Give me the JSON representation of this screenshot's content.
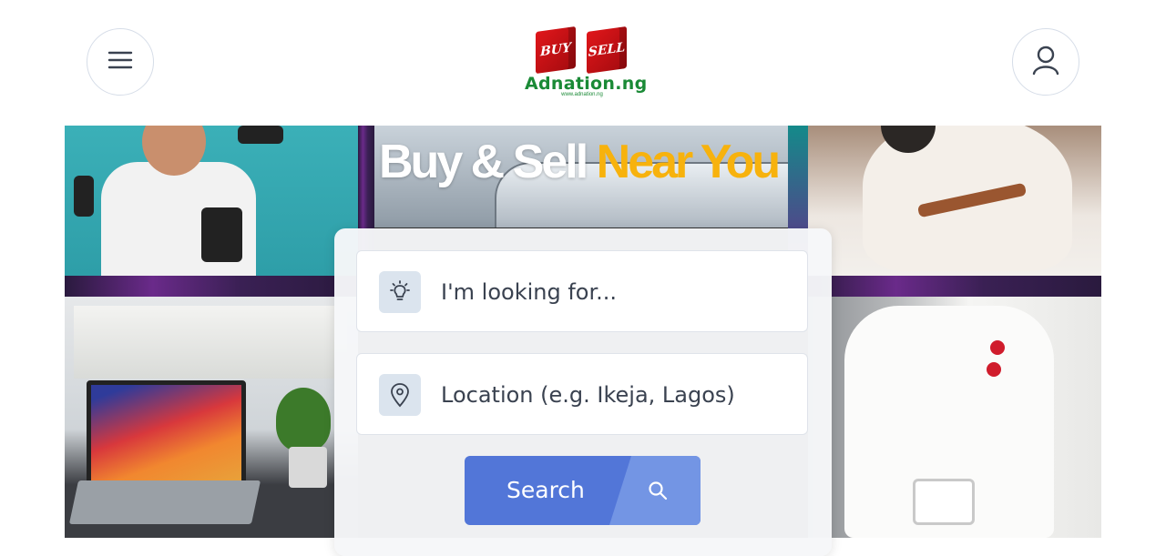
{
  "header": {
    "menu_icon": "hamburger-menu-icon",
    "account_icon": "user-icon",
    "logo": {
      "cube_left_text": "BUY",
      "cube_right_text": "SELL",
      "name": "Adnation.ng",
      "url": "www.adnation.ng"
    }
  },
  "hero": {
    "tagline_white": "Buy & Sell ",
    "tagline_yellow": "Near You"
  },
  "search": {
    "keyword_placeholder": "I'm looking for...",
    "keyword_icon": "lightbulb-icon",
    "location_placeholder": "Location (e.g. Ikeja, Lagos)",
    "location_icon": "map-pin-icon",
    "button_label": "Search",
    "button_icon": "search-icon"
  },
  "colors": {
    "brand_green": "#1a8a36",
    "brand_red": "#d01c2c",
    "accent_blue": "#5276d8",
    "accent_blue_light": "#7395e4",
    "tagline_yellow": "#f7b20d"
  }
}
